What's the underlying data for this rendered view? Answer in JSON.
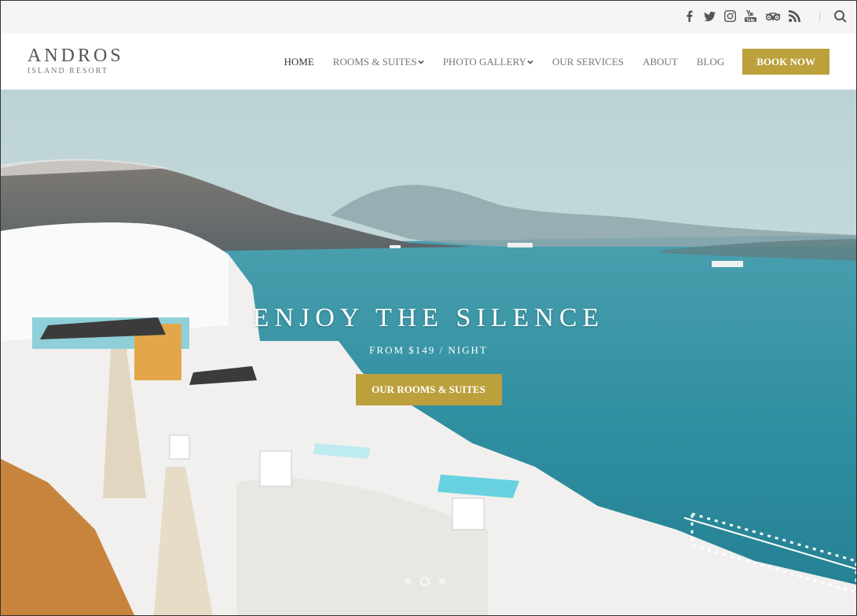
{
  "social": {
    "icons": [
      "facebook-icon",
      "twitter-icon",
      "instagram-icon",
      "youtube-icon",
      "tripadvisor-icon",
      "rss-icon"
    ],
    "search_icon": "search-icon"
  },
  "logo": {
    "name": "ANDROS",
    "tagline": "ISLAND RESORT"
  },
  "nav": {
    "home": "HOME",
    "rooms": "ROOMS & SUITES",
    "gallery": "PHOTO GALLERY",
    "services": "OUR SERVICES",
    "about": "ABOUT",
    "blog": "BLOG",
    "book": "BOOK NOW"
  },
  "hero": {
    "title": "ENJOY THE SILENCE",
    "subtitle": "FROM $149 / NIGHT",
    "button": "OUR ROOMS & SUITES",
    "slides": 3,
    "active_slide": 2
  },
  "colors": {
    "accent": "#bca03c",
    "sea": "#2f8fa0",
    "sky": "#c9dde0"
  }
}
